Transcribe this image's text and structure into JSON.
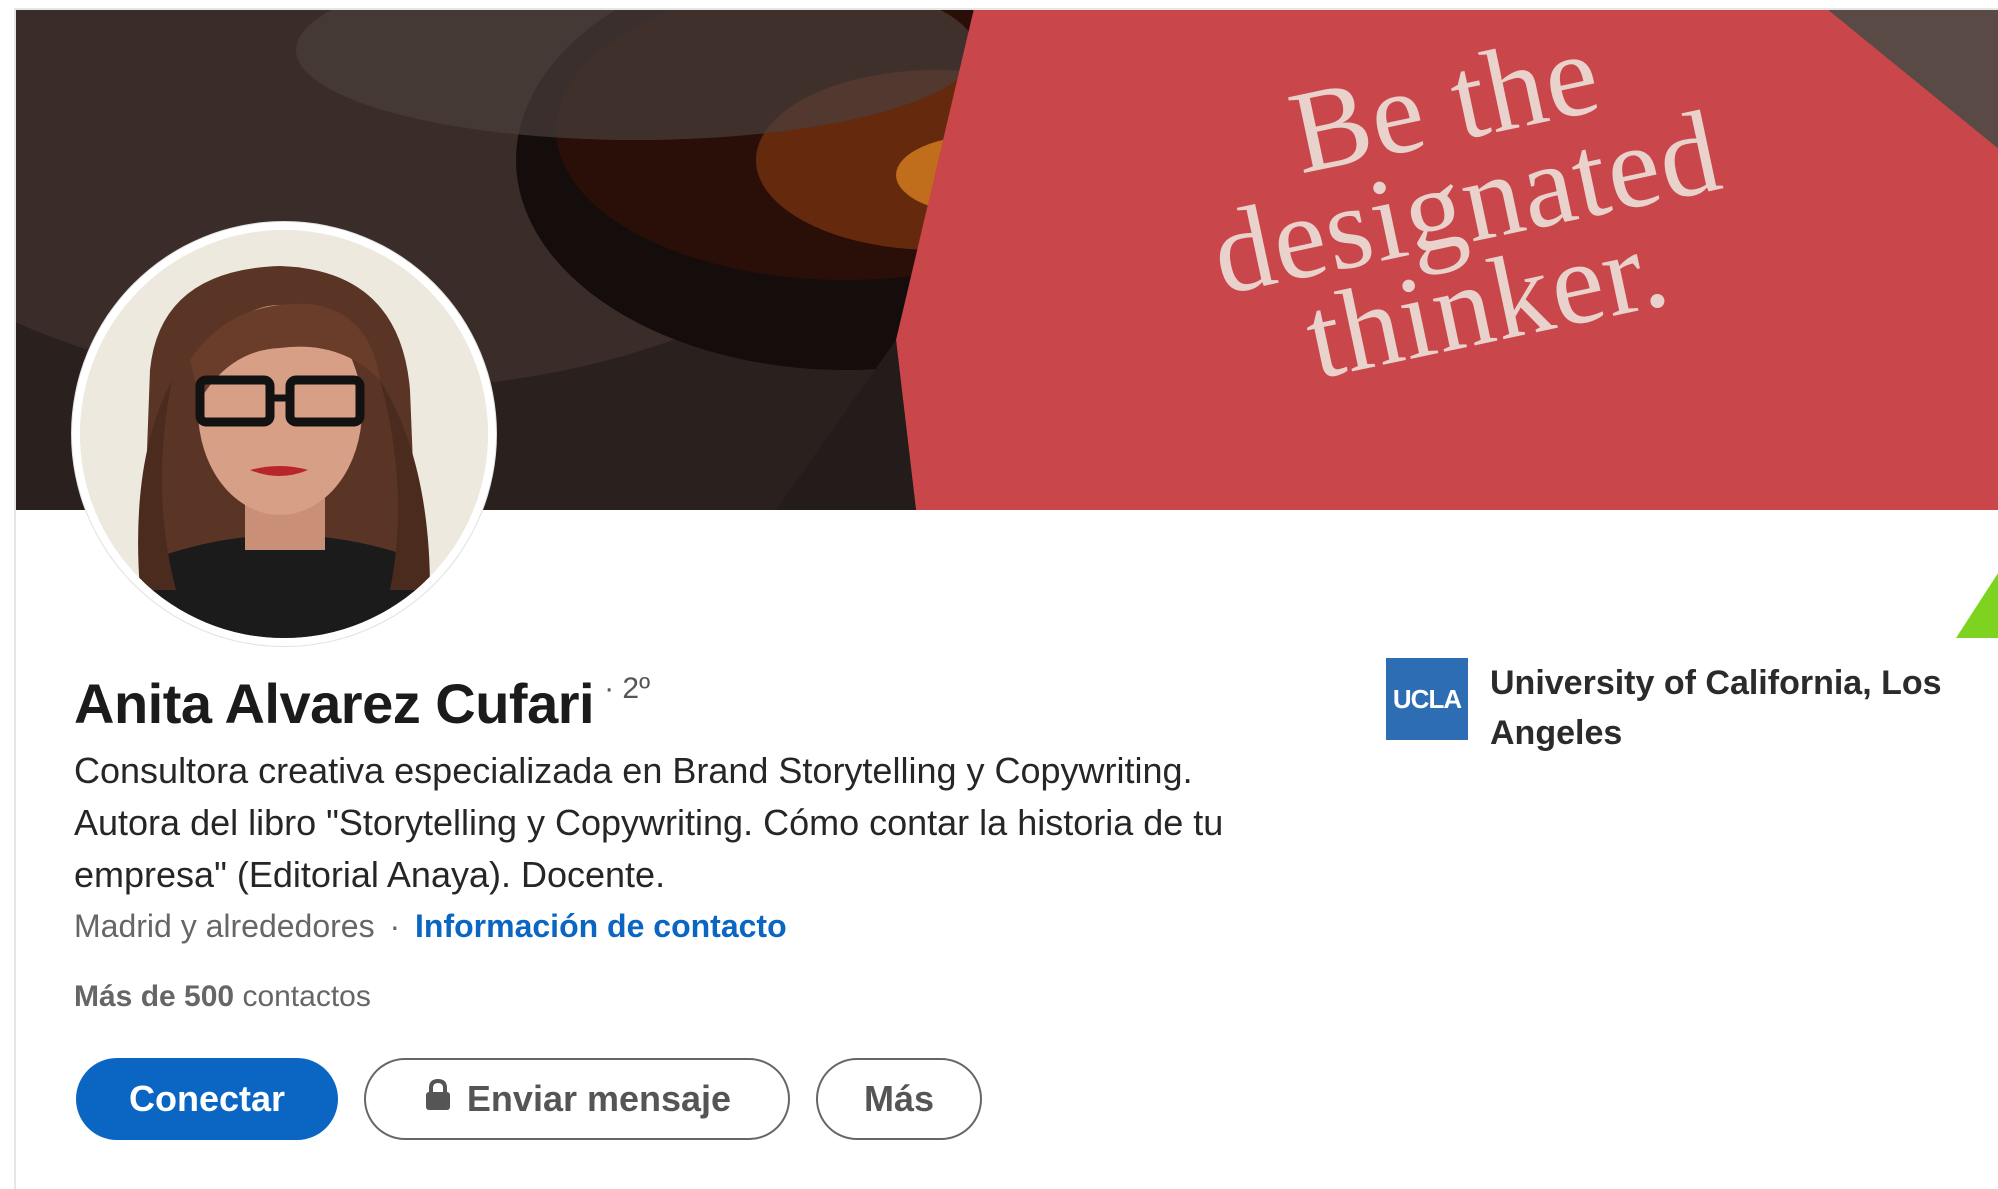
{
  "banner": {
    "slogan_lines": [
      "Be the",
      "designated",
      "thinker."
    ]
  },
  "profile": {
    "name": "Anita Alvarez Cufari",
    "degree": "· 2º",
    "headline": "Consultora creativa especializada en Brand Storytelling y Copywriting. Autora del libro \"Storytelling y Copywriting. Cómo contar la historia de tu empresa\" (Editorial Anaya). Docente.",
    "location": "Madrid y alrededores",
    "separator": "·",
    "contact_link": "Información de contacto",
    "connections_bold": "Más de 500",
    "connections_rest": "contactos"
  },
  "actions": {
    "connect": "Conectar",
    "message": "Enviar mensaje",
    "more": "Más"
  },
  "school": {
    "logo_text": "UCLA",
    "name": "University of California, Los Angeles"
  },
  "colors": {
    "primary": "#0a66c2",
    "school_logo": "#2d6db3",
    "arrow": "#7ed321",
    "banner_card": "#c9474a"
  },
  "icons": {
    "message_button": "lock-icon"
  }
}
